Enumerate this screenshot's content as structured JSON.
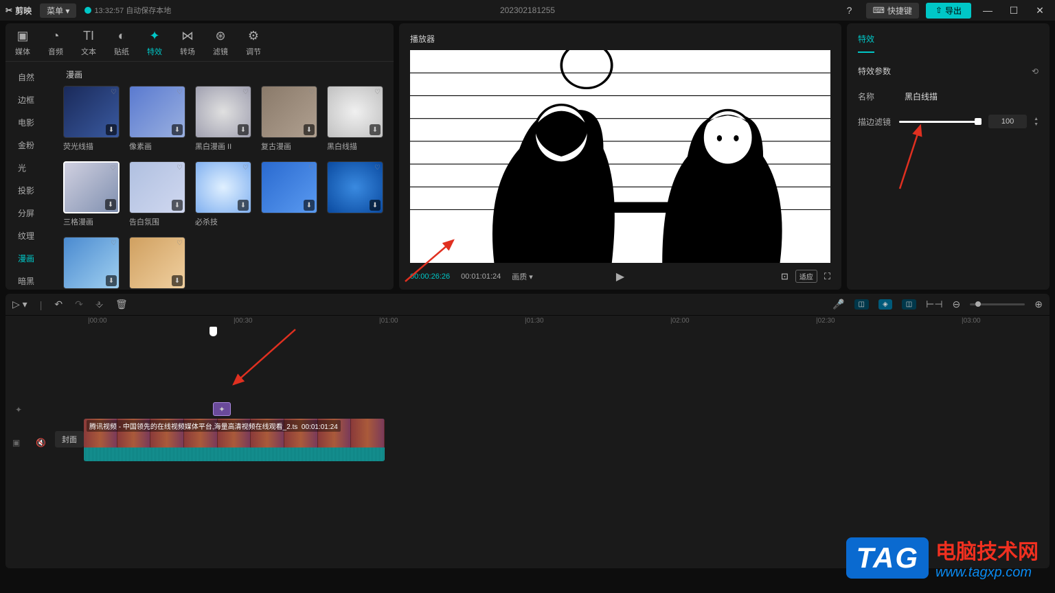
{
  "titlebar": {
    "logo": "剪映",
    "menu": "菜单 ▾",
    "save_time": "13:32:57 自动保存本地",
    "project": "202302181255",
    "help": "?",
    "hotkey": "快捷键",
    "export": "导出",
    "min": "—",
    "max": "☐",
    "close": "✕"
  },
  "top_tabs": [
    {
      "icon": "▣",
      "label": "媒体"
    },
    {
      "icon": "◔",
      "label": "音频"
    },
    {
      "icon": "TI",
      "label": "文本"
    },
    {
      "icon": "◐",
      "label": "贴纸"
    },
    {
      "icon": "✦",
      "label": "特效",
      "active": true
    },
    {
      "icon": "⋈",
      "label": "转场"
    },
    {
      "icon": "⊛",
      "label": "滤镜"
    },
    {
      "icon": "⚙",
      "label": "调节"
    }
  ],
  "side_cats": [
    "自然",
    "边框",
    "电影",
    "金粉",
    "光",
    "投影",
    "分屏",
    "纹理",
    "漫画",
    "暗黑"
  ],
  "side_active": "漫画",
  "fx_heading": "漫画",
  "fx_items": [
    {
      "label": "荧光线描"
    },
    {
      "label": "像素画"
    },
    {
      "label": "黑白漫画 II"
    },
    {
      "label": "复古漫画"
    },
    {
      "label": "黑白线描"
    },
    {
      "label": "三格漫画",
      "sel": true
    },
    {
      "label": "告白氛围"
    },
    {
      "label": "必杀技"
    },
    {
      "label": ""
    },
    {
      "label": ""
    },
    {
      "label": ""
    },
    {
      "label": ""
    }
  ],
  "preview": {
    "title": "播放器",
    "cur": "00:00:26:26",
    "dur": "00:01:01:24",
    "quality": "画质 ▾",
    "fit": "适应"
  },
  "props": {
    "tab": "特效",
    "section": "特效参数",
    "reset_icon": "⟲",
    "name_label": "名称",
    "name_value": "黑白线描",
    "slider_label": "描边滤镜",
    "slider_value": "100"
  },
  "timeline": {
    "marks": [
      "00:00",
      "00:30",
      "01:00",
      "01:30",
      "02:00",
      "02:30",
      "03:00"
    ],
    "clip_title": "腾讯视频 - 中国领先的在线视频媒体平台,海量高清视频在线观看_2.ts",
    "clip_dur": "00:01:01:24",
    "cover": "封面",
    "fx_clip_icon": "✦"
  },
  "watermark": {
    "tag": "TAG",
    "cn": "电脑技术网",
    "url": "www.tagxp.com"
  }
}
